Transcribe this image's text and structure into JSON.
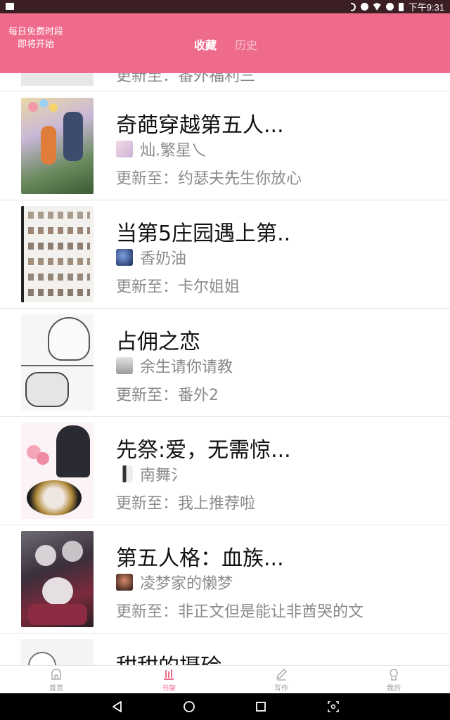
{
  "status_bar": {
    "time": "下午9:31"
  },
  "header": {
    "promo_line1": "每日免费时段",
    "promo_line2": "即将开始",
    "tabs": [
      {
        "label": "收藏",
        "active": true
      },
      {
        "label": "历史",
        "active": false
      }
    ],
    "bg_color": "#ef6b8b"
  },
  "list": {
    "partial_top": {
      "text": "更新至：番外福利三"
    },
    "items": [
      {
        "title": "奇葩穿越第五人...",
        "author": "灿.繁星乀",
        "update": "更新至：约瑟夫先生你放心"
      },
      {
        "title": "当第5庄园遇上第..",
        "author": "香奶油",
        "update": "更新至：卡尔姐姐"
      },
      {
        "title": "占佣之恋",
        "author": "余生请你请教",
        "update": "更新至：番外2"
      },
      {
        "title": "先祭:爱，无需惊...",
        "author": "南舞氵",
        "update": "更新至：我上推荐啦"
      },
      {
        "title": "第五人格：血族...",
        "author": "凌梦家的懒梦",
        "update": "更新至：非正文但是能让非酋哭的文"
      },
      {
        "title": "甜甜的摄硷",
        "author": "",
        "update": ""
      }
    ]
  },
  "bottom_nav": [
    {
      "label": "首页",
      "icon": "home-icon",
      "active": false
    },
    {
      "label": "书架",
      "icon": "bookshelf-icon",
      "active": true
    },
    {
      "label": "写作",
      "icon": "pencil-icon",
      "active": false
    },
    {
      "label": "我的",
      "icon": "profile-icon",
      "active": false
    }
  ],
  "system_nav": {
    "icons": [
      "back-icon",
      "home-circle-icon",
      "recents-icon",
      "screenshot-icon"
    ]
  }
}
